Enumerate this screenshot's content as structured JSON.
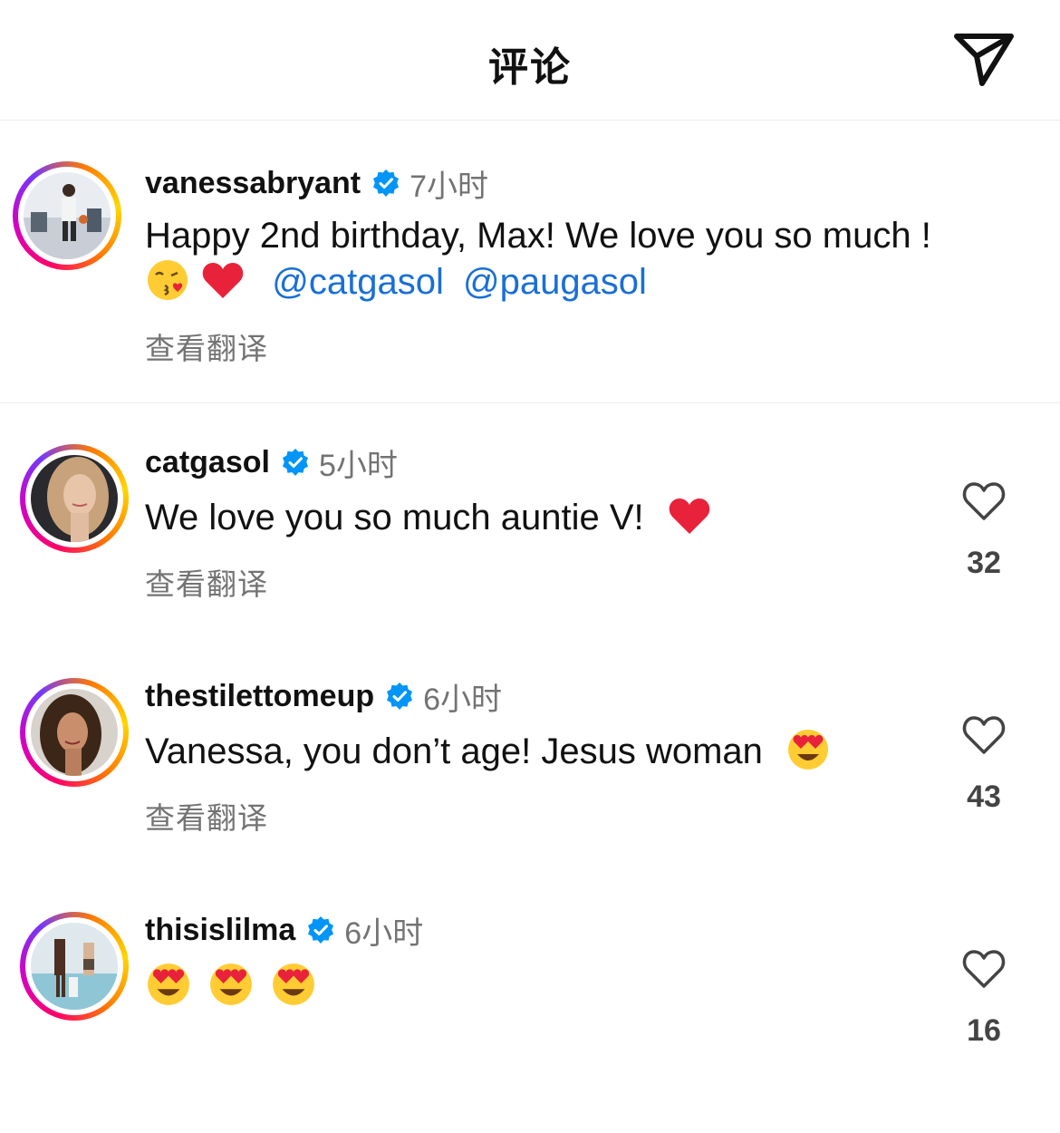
{
  "header": {
    "title": "评论",
    "share_icon": "send-icon"
  },
  "caption": {
    "username": "vanessabryant",
    "time": "7小时",
    "text": "Happy 2nd birthday, Max! We love you so much !",
    "emojis": [
      "kissing-face-emoji",
      "red-heart-emoji"
    ],
    "mentions": [
      "@catgasol",
      "@paugasol"
    ],
    "translate": "查看翻译"
  },
  "comments": [
    {
      "username": "catgasol",
      "time": "5小时",
      "text": "We love you so much auntie V!",
      "emoji": "red-heart-emoji",
      "translate": "查看翻译",
      "likes": "32"
    },
    {
      "username": "thestilettomeup",
      "time": "6小时",
      "text": "Vanessa, you don’t age! Jesus woman",
      "emoji": "heart-eyes-emoji",
      "translate": "查看翻译",
      "likes": "43"
    },
    {
      "username": "thisislilma",
      "time": "6小时",
      "emojis": [
        "heart-eyes-emoji",
        "heart-eyes-emoji",
        "heart-eyes-emoji"
      ],
      "likes": "16"
    }
  ],
  "colors": {
    "link": "#1a6fd6",
    "verified": "#0095f6",
    "muted": "#737373"
  }
}
